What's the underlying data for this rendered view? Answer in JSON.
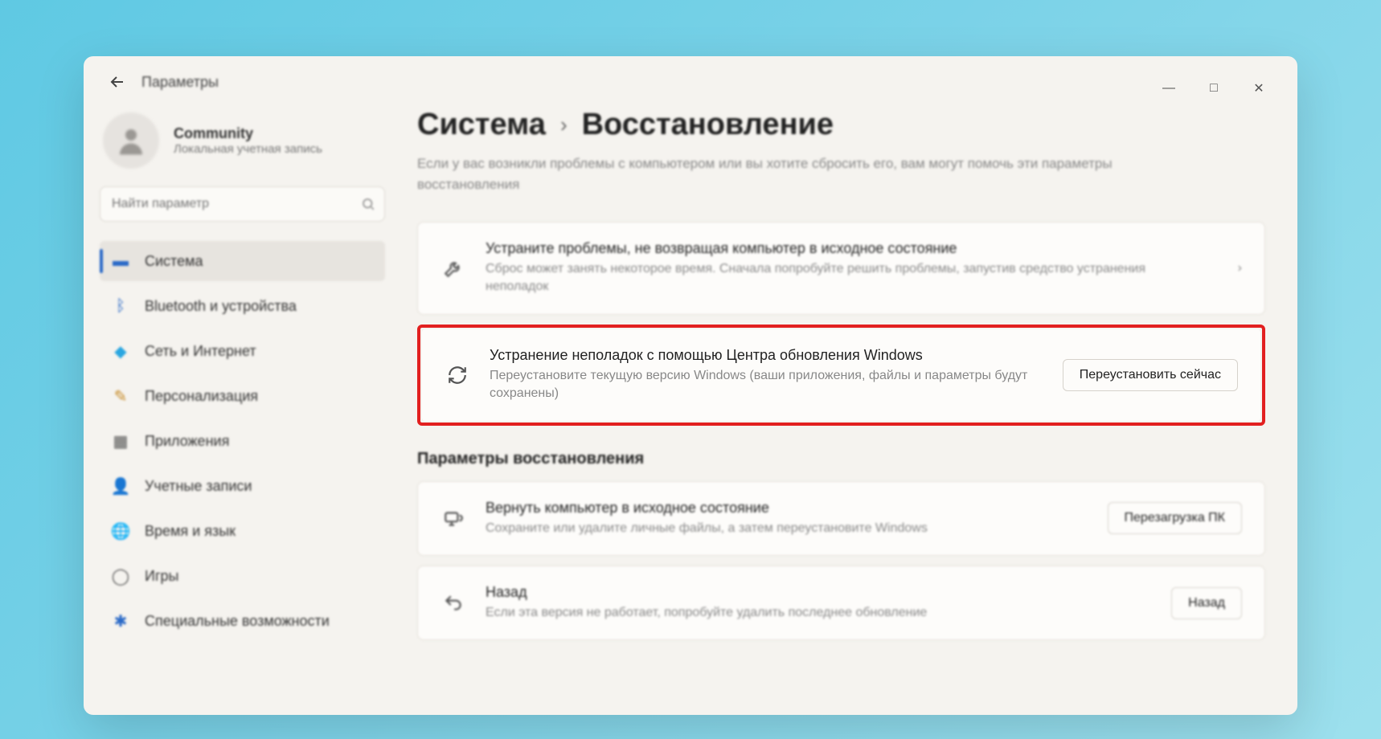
{
  "app_title": "Параметры",
  "window_controls": {
    "min": "—",
    "max": "□",
    "close": "✕"
  },
  "user": {
    "name": "Community",
    "type": "Локальная учетная запись"
  },
  "search": {
    "placeholder": "Найти параметр"
  },
  "nav": [
    {
      "label": "Система",
      "icon": "💻",
      "color": "#2a69c7"
    },
    {
      "label": "Bluetooth и устройства",
      "icon": "ᛒ",
      "color": "#2a69c7"
    },
    {
      "label": "Сеть и Интернет",
      "icon": "◆",
      "color": "#2aa6e0"
    },
    {
      "label": "Персонализация",
      "icon": "✎",
      "color": "#c78c2a"
    },
    {
      "label": "Приложения",
      "icon": "▦",
      "color": "#555"
    },
    {
      "label": "Учетные записи",
      "icon": "👤",
      "color": "#2aa64f"
    },
    {
      "label": "Время и язык",
      "icon": "🌐",
      "color": "#2a69c7"
    },
    {
      "label": "Игры",
      "icon": "◯",
      "color": "#555"
    },
    {
      "label": "Специальные возможности",
      "icon": "✱",
      "color": "#2a69c7"
    }
  ],
  "breadcrumb": {
    "parent": "Система",
    "current": "Восстановление"
  },
  "subtitle": "Если у вас возникли проблемы с компьютером или вы хотите сбросить его, вам могут помочь эти параметры восстановления",
  "card_troubleshoot": {
    "title": "Устраните проблемы, не возвращая компьютер в исходное состояние",
    "desc": "Сброс может занять некоторое время. Сначала попробуйте решить проблемы, запустив средство устранения неполадок"
  },
  "card_wu": {
    "title": "Устранение неполадок с помощью Центра обновления Windows",
    "desc": "Переустановите текущую версию Windows (ваши приложения, файлы и параметры будут сохранены)",
    "action": "Переустановить сейчас"
  },
  "section_recovery_title": "Параметры восстановления",
  "card_reset": {
    "title": "Вернуть компьютер в исходное состояние",
    "desc": "Сохраните или удалите личные файлы, а затем переустановите Windows",
    "action": "Перезагрузка ПК"
  },
  "card_goback": {
    "title": "Назад",
    "desc": "Если эта версия не работает, попробуйте удалить последнее обновление",
    "action": "Назад"
  }
}
